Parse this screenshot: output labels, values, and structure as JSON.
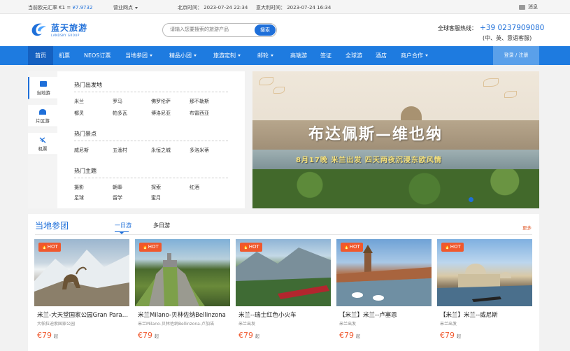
{
  "topbar": {
    "rate_label": "当前欧元汇率 €1 = ",
    "rate_value": "¥7.9732",
    "outlet": "营业网点",
    "beijing_time": "北京时间：  2023-07-24 22:34",
    "italy_time": "意大利时间：  2023-07-24 16:34",
    "messages": "消息"
  },
  "header": {
    "logo_cn": "蓝天旅游",
    "logo_en": "LANDSKY GROUP",
    "search_placeholder": "请输入您要搜索的旅游产品",
    "search_button": "搜索",
    "hotline_label": "全球客服热线：",
    "hotline_number": "+39 0237909080",
    "hotline_langs": "(中、英、意语客服)"
  },
  "nav": {
    "items": [
      "首页",
      "机票",
      "NEOS订票",
      "当地参团",
      "精品小团",
      "旅游定制",
      "邮轮",
      "高端游",
      "签证",
      "全球游",
      "酒店",
      "商户合作"
    ],
    "login": "登录 / 注册"
  },
  "categories": {
    "tabs": [
      "当地游",
      "片区游",
      "机票"
    ],
    "hot_departure": {
      "title": "热门出发地",
      "links": [
        "米兰",
        "罗马",
        "佛罗伦萨",
        "那不勒斯",
        "都灵",
        "帕多瓦",
        "博洛尼亚",
        "布雷西亚"
      ]
    },
    "hot_spots": {
      "title": "热门景点",
      "links": [
        "威尼斯",
        "五渔村",
        "永恒之城",
        "多洛米蒂"
      ]
    },
    "hot_themes": {
      "title": "热门主题",
      "links": [
        "摄影",
        "朝奉",
        "探索",
        "红酒",
        "足球",
        "留学",
        "蜜月"
      ]
    }
  },
  "banner": {
    "title": "布达佩斯—维也纳",
    "subtitle": "8月17晚  米兰出发  四天两夜沉浸东欧风情"
  },
  "local_tours": {
    "title": "当地参团",
    "tabs": [
      "一日游",
      "多日游"
    ],
    "more": "更多",
    "cards": [
      {
        "hot": "HOT",
        "title": "米兰-大天堂国家公园Gran Paradiso",
        "sub": "大帕拉迪索国家公园",
        "price": "€79",
        "unit": "起"
      },
      {
        "hot": "HOT",
        "title": "米兰Milano-贝林佐纳Bellinzona",
        "sub": "米兰Milano-贝林佐纳Bellinzona-卢加诺",
        "price": "€79",
        "unit": "起"
      },
      {
        "hot": "HOT",
        "title": "米兰--瑞士红色小火车",
        "sub": "米兰出发",
        "price": "€79",
        "unit": "起"
      },
      {
        "hot": "HOT",
        "title": "【米兰】米兰--卢塞恩",
        "sub": "米兰出发",
        "price": "€79",
        "unit": "起"
      },
      {
        "hot": "HOT",
        "title": "【米兰】米兰--威尼斯",
        "sub": "米兰出发",
        "price": "€79",
        "unit": "起"
      }
    ]
  }
}
